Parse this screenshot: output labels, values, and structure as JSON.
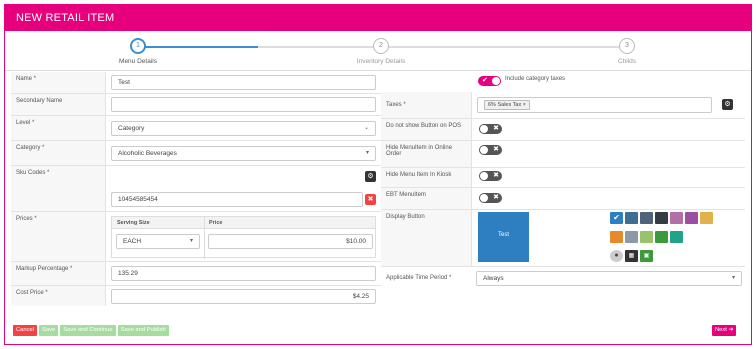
{
  "title": "NEW RETAIL ITEM",
  "steps": [
    {
      "num": "1",
      "label": "Menu Details"
    },
    {
      "num": "2",
      "label": "Inventory Details"
    },
    {
      "num": "3",
      "label": "Childs"
    }
  ],
  "form": {
    "name": {
      "label": "Name *",
      "value": "Test"
    },
    "secondary_name": {
      "label": "Secondary Name",
      "value": ""
    },
    "level": {
      "label": "Level *",
      "value": "Category"
    },
    "category": {
      "label": "Category *",
      "value": "Alcoholic Beverages"
    },
    "sku": {
      "label": "Sku Codes *",
      "value": "10454585454"
    },
    "prices": {
      "label": "Prices *",
      "col_size": "Serving Size",
      "col_price": "Price",
      "size": "EACH",
      "price": "$10.00"
    },
    "markup": {
      "label": "Markup Percentage *",
      "value": "135.29"
    },
    "cost": {
      "label": "Cost Price *",
      "value": "$4.25"
    }
  },
  "right": {
    "include_tax": {
      "label": "Include category taxes",
      "on": true
    },
    "taxes": {
      "label": "Taxes *",
      "chip": "6% Sales Tax ×"
    },
    "no_show_pos": {
      "label": "Do not show Button on POS",
      "on": false
    },
    "hide_online": {
      "label": "Hide MenuItem in Online Order",
      "on": false
    },
    "hide_kiosk": {
      "label": "Hide Menu Item In Kiosk",
      "on": false
    },
    "ebt": {
      "label": "EBT MenuItem",
      "on": false
    },
    "display_button": {
      "label": "Display Button",
      "preview": "Test",
      "preview_color": "#2d7fc1"
    },
    "swatches": [
      "#2d7fc1",
      "#3f6e94",
      "#4e6278",
      "#343b45",
      "#b26fa7",
      "#9a4fa0",
      "#e3b14a",
      "#e58a2c",
      "#8b9aa6",
      "#9ac26b",
      "#3c9a3a",
      "#21a38a"
    ],
    "time_period": {
      "label": "Applicable Time Period *",
      "value": "Always"
    }
  },
  "buttons": {
    "cancel": "Cancel",
    "save": "Save",
    "save_continue": "Save and Continue",
    "save_publish": "Save and Publish",
    "next": "Next ➔"
  },
  "colors": {
    "brand": "#e6007e",
    "accent": "#3b8fd0",
    "danger": "#f04444",
    "save": "#a7dca0"
  }
}
